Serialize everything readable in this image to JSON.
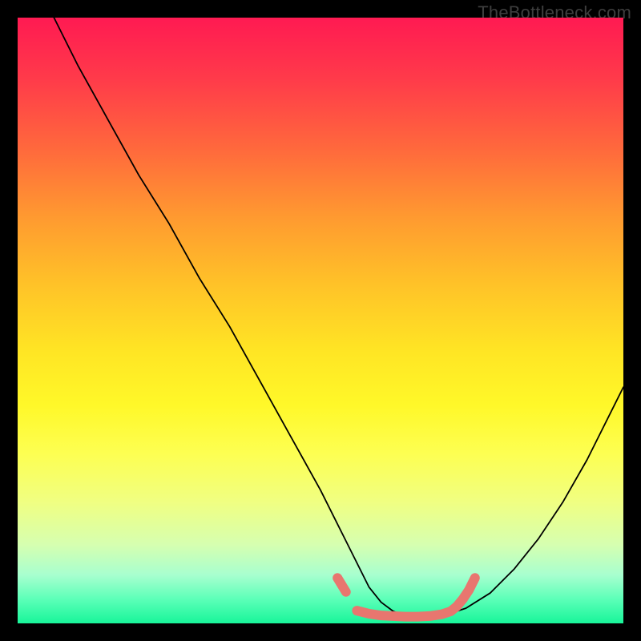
{
  "watermark": "TheBottleneck.com",
  "chart_data": {
    "type": "line",
    "title": "",
    "xlabel": "",
    "ylabel": "",
    "xlim": [
      0,
      100
    ],
    "ylim": [
      0,
      100
    ],
    "series": [
      {
        "name": "curve",
        "x": [
          6,
          10,
          15,
          20,
          25,
          30,
          35,
          40,
          45,
          50,
          52,
          54,
          56,
          58,
          60,
          62,
          64,
          66,
          68,
          70,
          74,
          78,
          82,
          86,
          90,
          94,
          98,
          100
        ],
        "y": [
          100,
          92,
          83,
          74,
          66,
          57,
          49,
          40,
          31,
          22,
          18,
          14,
          10,
          6,
          3.5,
          2,
          1.2,
          1,
          1,
          1.2,
          2.5,
          5,
          9,
          14,
          20,
          27,
          35,
          39
        ],
        "color": "#000000"
      },
      {
        "name": "highlight-left",
        "x": [
          52.8,
          54.2
        ],
        "y": [
          7.5,
          5.2
        ],
        "color": "#e8766f"
      },
      {
        "name": "highlight-flat",
        "x": [
          56,
          58,
          60,
          62,
          64,
          66,
          68,
          70,
          71.5,
          72.5
        ],
        "y": [
          2.1,
          1.6,
          1.3,
          1.2,
          1.1,
          1.1,
          1.2,
          1.5,
          2.0,
          2.8
        ],
        "color": "#e8766f"
      },
      {
        "name": "highlight-right",
        "x": [
          72.5,
          73.5,
          74.5,
          75.5
        ],
        "y": [
          2.8,
          4.0,
          5.5,
          7.5
        ],
        "color": "#e8766f"
      }
    ]
  }
}
